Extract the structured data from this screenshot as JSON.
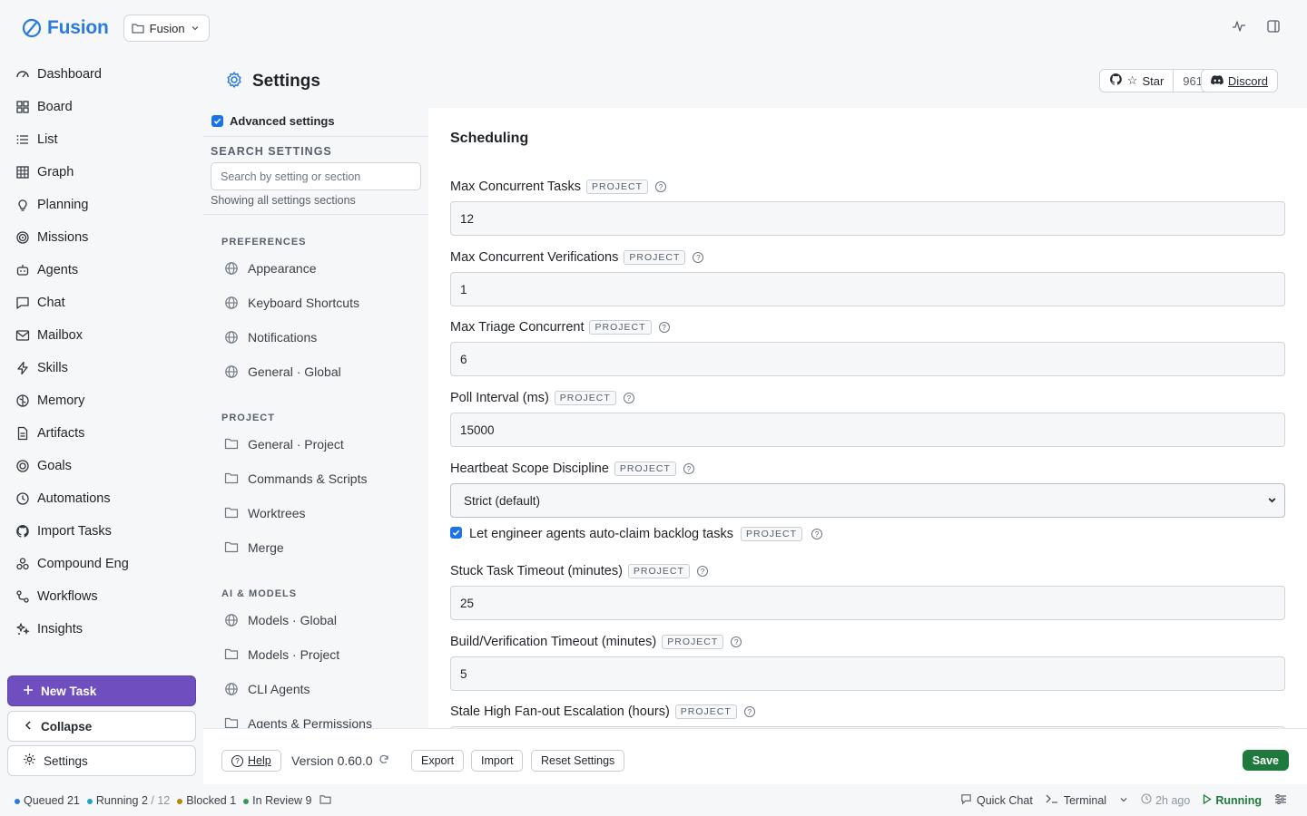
{
  "app": {
    "brand": "Fusion",
    "project_selector": "Fusion"
  },
  "sidebar": {
    "items": [
      {
        "label": "Dashboard",
        "icon": "dashboard-icon"
      },
      {
        "label": "Board",
        "icon": "board-icon"
      },
      {
        "label": "List",
        "icon": "list-icon"
      },
      {
        "label": "Graph",
        "icon": "graph-icon"
      },
      {
        "label": "Planning",
        "icon": "lightbulb-icon"
      },
      {
        "label": "Missions",
        "icon": "target-icon"
      },
      {
        "label": "Agents",
        "icon": "robot-icon"
      },
      {
        "label": "Chat",
        "icon": "chat-icon"
      },
      {
        "label": "Mailbox",
        "icon": "mail-icon"
      },
      {
        "label": "Skills",
        "icon": "lightning-icon"
      },
      {
        "label": "Memory",
        "icon": "brain-icon"
      },
      {
        "label": "Artifacts",
        "icon": "file-icon"
      },
      {
        "label": "Goals",
        "icon": "goal-icon"
      },
      {
        "label": "Automations",
        "icon": "clock-icon"
      },
      {
        "label": "Import Tasks",
        "icon": "github-icon"
      },
      {
        "label": "Compound Eng",
        "icon": "compound-icon"
      },
      {
        "label": "Workflows",
        "icon": "workflow-icon"
      },
      {
        "label": "Insights",
        "icon": "sparkles-icon"
      }
    ],
    "new_task": "New Task",
    "collapse": "Collapse",
    "settings": "Settings"
  },
  "header": {
    "title": "Settings",
    "github_star": "Star",
    "github_count": "961",
    "discord": "Discord"
  },
  "settings_nav": {
    "advanced_label": "Advanced settings",
    "advanced_checked": true,
    "search_heading": "SEARCH SETTINGS",
    "search_placeholder": "Search by setting or section",
    "search_hint": "Showing all settings sections",
    "groups": [
      {
        "heading": "PREFERENCES",
        "items": [
          {
            "label": "Appearance",
            "icon": "globe-icon"
          },
          {
            "label": "Keyboard Shortcuts",
            "icon": "globe-icon"
          },
          {
            "label": "Notifications",
            "icon": "globe-icon"
          },
          {
            "label": "General · Global",
            "icon": "globe-icon"
          }
        ]
      },
      {
        "heading": "PROJECT",
        "items": [
          {
            "label": "General · Project",
            "icon": "folder-icon"
          },
          {
            "label": "Commands & Scripts",
            "icon": "folder-icon"
          },
          {
            "label": "Worktrees",
            "icon": "folder-icon"
          },
          {
            "label": "Merge",
            "icon": "folder-icon"
          }
        ]
      },
      {
        "heading": "AI & MODELS",
        "items": [
          {
            "label": "Models · Global",
            "icon": "globe-icon"
          },
          {
            "label": "Models · Project",
            "icon": "folder-icon"
          },
          {
            "label": "CLI Agents",
            "icon": "globe-icon"
          },
          {
            "label": "Agents & Permissions",
            "icon": "folder-icon"
          }
        ]
      }
    ]
  },
  "content": {
    "section_title": "Scheduling",
    "scope_badge": "PROJECT",
    "fields": [
      {
        "label": "Max Concurrent Tasks",
        "value": "12",
        "type": "input"
      },
      {
        "label": "Max Concurrent Verifications",
        "value": "1",
        "type": "input"
      },
      {
        "label": "Max Triage Concurrent",
        "value": "6",
        "type": "input"
      },
      {
        "label": "Poll Interval (ms)",
        "value": "15000",
        "type": "input"
      },
      {
        "label": "Heartbeat Scope Discipline",
        "value": "Strict (default)",
        "type": "select"
      },
      {
        "label": "Let engineer agents auto-claim backlog tasks",
        "checked": true,
        "type": "checkbox"
      },
      {
        "label": "Stuck Task Timeout (minutes)",
        "value": "25",
        "type": "input"
      },
      {
        "label": "Build/Verification Timeout (minutes)",
        "value": "5",
        "type": "input"
      },
      {
        "label": "Stale High Fan-out Escalation (hours)",
        "value": "",
        "type": "input"
      }
    ]
  },
  "footer": {
    "help": "Help",
    "version": "Version 0.60.0",
    "export": "Export",
    "import": "Import",
    "reset": "Reset Settings",
    "save": "Save"
  },
  "statusbar": {
    "queued_label": "Queued",
    "queued_count": "21",
    "running_label": "Running",
    "running_count": "2",
    "running_sep": "/",
    "running_total": "12",
    "blocked_label": "Blocked",
    "blocked_count": "1",
    "review_label": "In Review",
    "review_count": "9",
    "quick_chat": "Quick Chat",
    "terminal": "Terminal",
    "last_update": "2h ago",
    "engine_status": "Running",
    "colors": {
      "queued": "#2a7ae2",
      "running": "#1ca3c7",
      "blocked": "#b8860b",
      "review": "#2e9e53"
    }
  }
}
